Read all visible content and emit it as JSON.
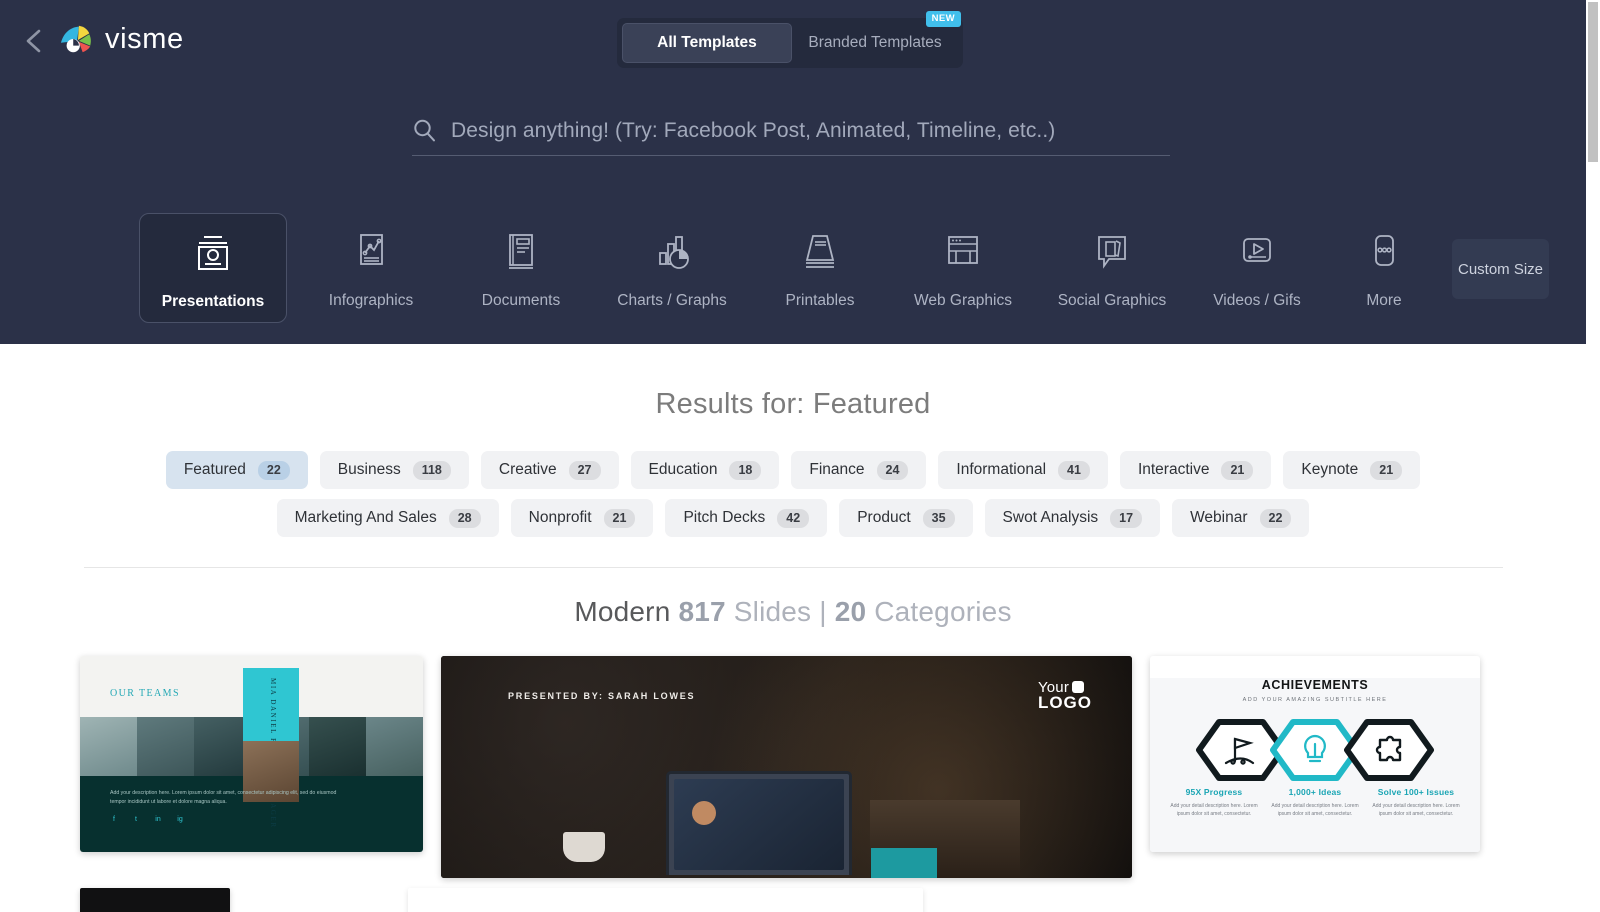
{
  "header": {
    "back_label": "Back",
    "brand_name": "visme",
    "tabs": [
      {
        "label": "All Templates",
        "active": true
      },
      {
        "label": "Branded Templates",
        "active": false,
        "badge": "NEW"
      }
    ],
    "search": {
      "placeholder": "Design anything! (Try: Facebook Post, Animated, Timeline, etc..)",
      "value": ""
    },
    "categories": [
      {
        "label": "Presentations",
        "icon": "presentation-icon",
        "active": true
      },
      {
        "label": "Infographics",
        "icon": "infographic-chart-icon",
        "active": false
      },
      {
        "label": "Documents",
        "icon": "document-icon",
        "active": false
      },
      {
        "label": "Charts / Graphs",
        "icon": "bar-pie-chart-icon",
        "active": false
      },
      {
        "label": "Printables",
        "icon": "printable-icon",
        "active": false
      },
      {
        "label": "Web Graphics",
        "icon": "browser-window-icon",
        "active": false
      },
      {
        "label": "Social Graphics",
        "icon": "speech-bubble-cards-icon",
        "active": false
      },
      {
        "label": "Videos / Gifs",
        "icon": "video-play-icon",
        "active": false
      },
      {
        "label": "More",
        "icon": "ellipsis-icon",
        "active": false
      }
    ],
    "custom_size_label": "Custom Size",
    "colors": {
      "background": "#2b3148",
      "tab_bar": "#242a3d",
      "active_tab": "#3a4157",
      "badge": "#41bfec",
      "custom_size": "#333b52"
    }
  },
  "results": {
    "title": "Results for: Featured",
    "filters": [
      {
        "label": "Featured",
        "count": "22",
        "active": true
      },
      {
        "label": "Business",
        "count": "118",
        "active": false
      },
      {
        "label": "Creative",
        "count": "27",
        "active": false
      },
      {
        "label": "Education",
        "count": "18",
        "active": false
      },
      {
        "label": "Finance",
        "count": "24",
        "active": false
      },
      {
        "label": "Informational",
        "count": "41",
        "active": false
      },
      {
        "label": "Interactive",
        "count": "21",
        "active": false
      },
      {
        "label": "Keynote",
        "count": "21",
        "active": false
      },
      {
        "label": "Marketing And Sales",
        "count": "28",
        "active": false
      },
      {
        "label": "Nonprofit",
        "count": "21",
        "active": false
      },
      {
        "label": "Pitch Decks",
        "count": "42",
        "active": false
      },
      {
        "label": "Product",
        "count": "35",
        "active": false
      },
      {
        "label": "Swot Analysis",
        "count": "17",
        "active": false
      },
      {
        "label": "Webinar",
        "count": "22",
        "active": false
      }
    ]
  },
  "section": {
    "name": "Modern",
    "slides_count": "817",
    "slides_label": "Slides",
    "separator": "|",
    "categories_count": "20",
    "categories_label": "Categories"
  },
  "templates": [
    {
      "name": "our-teams-template",
      "heading": "OUR TEAMS",
      "accent_text": "MIA DANIEL  PROJECT MANAGER",
      "description": "Add your description here. Lorem ipsum dolor sit amet, consectetur adipiscing elit, sed do eiusmod tempor incididunt ut labore et dolore magna aliqua.",
      "socials": [
        "f",
        "t",
        "in",
        "ig"
      ]
    },
    {
      "name": "presented-by-template",
      "presented_by": "PRESENTED BY: SARAH LOWES",
      "logo_line1": "Your",
      "logo_line2": "LOGO"
    },
    {
      "name": "achievements-template",
      "heading": "ACHIEVEMENTS",
      "subtitle": "ADD YOUR AMAZING SUBTITLE HERE",
      "items": [
        {
          "icon": "flag-icon",
          "title": "95X Progress",
          "body": "Add your detail description here. Lorem ipsum dolor sit amet, consectetur."
        },
        {
          "icon": "lightbulb-icon",
          "title": "1,000+ Ideas",
          "body": "Add your detail description here. Lorem ipsum dolor sit amet, consectetur."
        },
        {
          "icon": "puzzle-icon",
          "title": "Solve 100+ Issues",
          "body": "Add your detail description here. Lorem ipsum dolor sit amet, consectetur."
        }
      ]
    }
  ]
}
